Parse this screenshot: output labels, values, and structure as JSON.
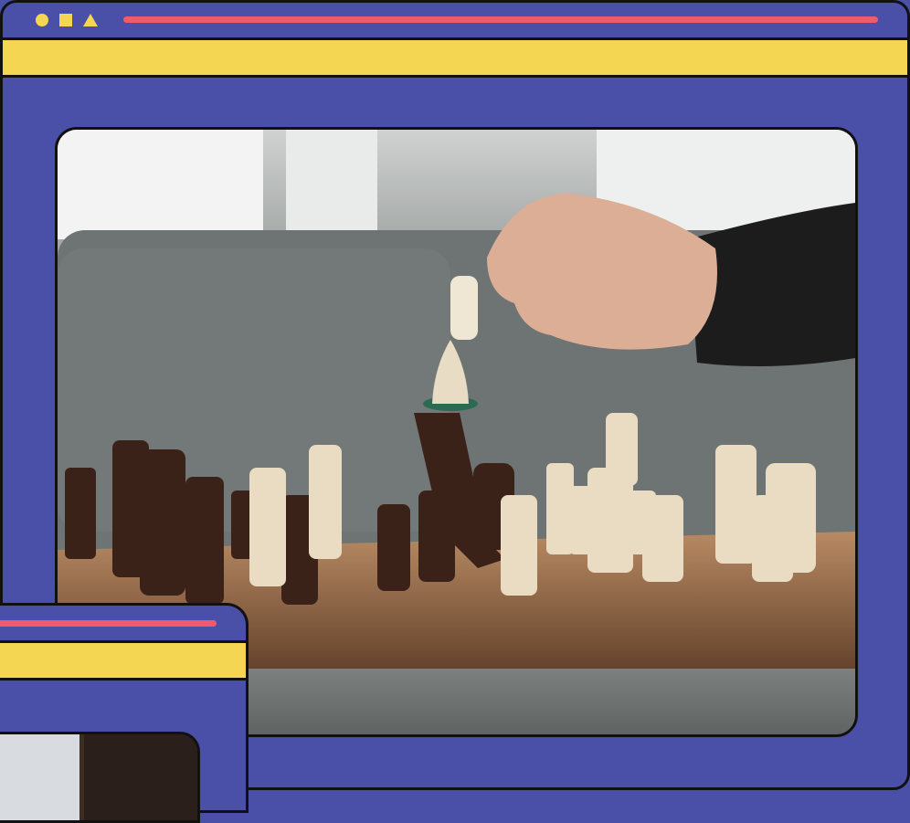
{
  "colors": {
    "window_bg": "#4a4fa8",
    "toolbar_yellow": "#f4d653",
    "accent_red": "#ef5b6a",
    "shape_yellow": "#f4d653",
    "outline": "#111111"
  },
  "icons": {
    "window_controls": [
      "circle-icon",
      "square-icon",
      "triangle-icon"
    ]
  }
}
